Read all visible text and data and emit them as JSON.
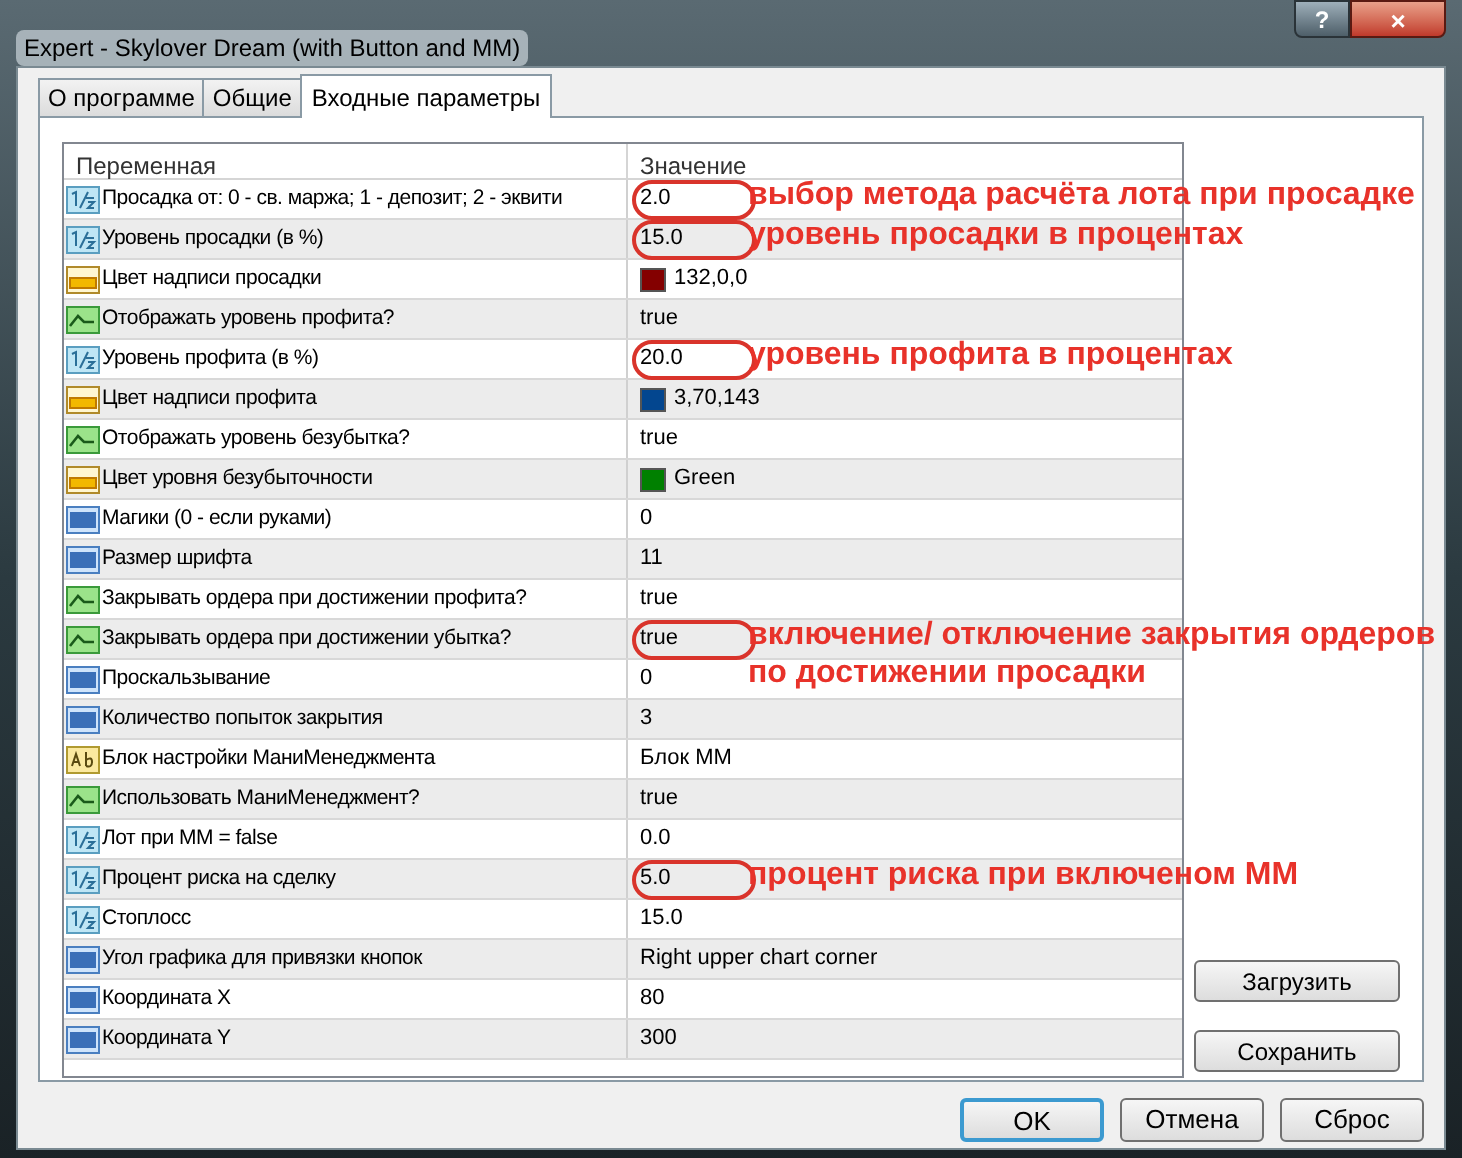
{
  "window": {
    "title": "Expert - Skylover Dream (with Button and MM)",
    "help_button": "?",
    "close_button": "×"
  },
  "tabs": [
    {
      "label": "О программе",
      "selected": false
    },
    {
      "label": "Общие",
      "selected": false
    },
    {
      "label": "Входные параметры",
      "selected": true
    }
  ],
  "table": {
    "columns": [
      "Переменная",
      "Значение"
    ],
    "rows": [
      {
        "kind": "double",
        "name": "Просадка от: 0 - св. маржа; 1 - депозит; 2 - эквити",
        "value": "2.0",
        "highlighted": true,
        "note": "выбор метода расчёта лота при просадке"
      },
      {
        "kind": "double",
        "name": "Уровень просадки (в %)",
        "value": "15.0",
        "highlighted": true,
        "note": "уровень просадки в процентах"
      },
      {
        "kind": "color",
        "name": "Цвет надписи просадки",
        "value": "132,0,0",
        "color": "#840000",
        "highlighted": false
      },
      {
        "kind": "bool",
        "name": "Отображать уровень профита?",
        "value": "true",
        "highlighted": false
      },
      {
        "kind": "double",
        "name": "Уровень профита (в %)",
        "value": "20.0",
        "highlighted": true,
        "note": "уровень профита в процентах"
      },
      {
        "kind": "color",
        "name": "Цвет надписи профита",
        "value": "3,70,143",
        "color": "#03468f",
        "highlighted": false
      },
      {
        "kind": "bool",
        "name": "Отображать уровень безубытка?",
        "value": "true",
        "highlighted": false
      },
      {
        "kind": "color",
        "name": "Цвет уровня безубыточности",
        "value": "Green",
        "color": "#008000",
        "highlighted": false
      },
      {
        "kind": "int",
        "name": "Магики (0 - если руками)",
        "value": "0",
        "highlighted": false
      },
      {
        "kind": "int",
        "name": "Размер шрифта",
        "value": "11",
        "highlighted": false
      },
      {
        "kind": "bool",
        "name": "Закрывать ордера при достижении профита?",
        "value": "true",
        "highlighted": false
      },
      {
        "kind": "bool",
        "name": "Закрывать ордера при достижении убытка?",
        "value": "true",
        "highlighted": true,
        "note": "включение/ отключение закрытия ордеров по достижении просадки"
      },
      {
        "kind": "int",
        "name": "Проскальзывание",
        "value": "0",
        "highlighted": false
      },
      {
        "kind": "int",
        "name": "Количество попыток закрытия",
        "value": "3",
        "highlighted": false
      },
      {
        "kind": "string",
        "name": "Блок настройки МаниМенеджмента",
        "value": "Блок ММ",
        "highlighted": false
      },
      {
        "kind": "bool",
        "name": "Использовать МаниМенеджмент?",
        "value": "true",
        "highlighted": false
      },
      {
        "kind": "double",
        "name": "Лот при ММ = false",
        "value": "0.0",
        "highlighted": false
      },
      {
        "kind": "double",
        "name": "Процент риска на сделку",
        "value": "5.0",
        "highlighted": true,
        "note": "процент риска при включеном ММ"
      },
      {
        "kind": "double",
        "name": "Стоплосс",
        "value": "15.0",
        "highlighted": false
      },
      {
        "kind": "int",
        "name": "Угол графика для привязки кнопок",
        "value": "Right upper chart corner",
        "highlighted": false
      },
      {
        "kind": "int",
        "name": "Координата X",
        "value": "80",
        "highlighted": false
      },
      {
        "kind": "int",
        "name": "Координата Y",
        "value": "300",
        "highlighted": false
      }
    ]
  },
  "side_buttons": [
    {
      "label": "Загрузить"
    },
    {
      "label": "Сохранить"
    }
  ],
  "buttons": [
    {
      "label": "OK",
      "default": true
    },
    {
      "label": "Отмена",
      "default": false
    },
    {
      "label": "Сброс",
      "default": false
    }
  ]
}
